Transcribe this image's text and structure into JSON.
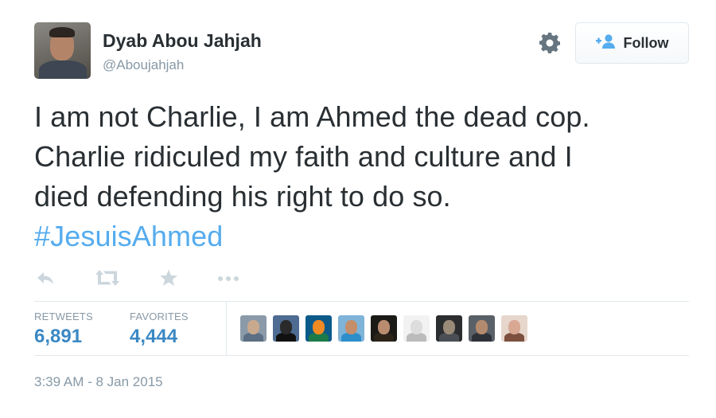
{
  "user": {
    "display_name": "Dyab Abou Jahjah",
    "handle": "@Aboujahjah"
  },
  "follow_button": {
    "label": "Follow",
    "icon": "add-person-icon"
  },
  "settings": {
    "icon": "gear-icon"
  },
  "tweet": {
    "lines": [
      "I am not Charlie, I am Ahmed the dead cop.",
      "Charlie ridiculed my faith and culture and I",
      "died defending his right to do so."
    ],
    "hashtag": "#JesuisAhmed"
  },
  "actions": [
    {
      "name": "reply",
      "icon": "reply-icon"
    },
    {
      "name": "retweet",
      "icon": "retweet-icon"
    },
    {
      "name": "favorite",
      "icon": "star-icon"
    },
    {
      "name": "more",
      "icon": "more-dots-icon"
    }
  ],
  "stats": {
    "retweets": {
      "label": "RETWEETS",
      "value": "6,891"
    },
    "favorites": {
      "label": "FAVORITES",
      "value": "4,444"
    }
  },
  "favoriters": [
    {
      "head": "#c9a98e",
      "body": "#5b6e84",
      "bg": "#8b9aa8"
    },
    {
      "head": "#2a2a2a",
      "body": "#111111",
      "bg": "#4e6c92"
    },
    {
      "head": "#f08a22",
      "body": "#1c7a4a",
      "bg": "#0b5a8a"
    },
    {
      "head": "#c48e6a",
      "body": "#2d8ec9",
      "bg": "#7fb3d8"
    },
    {
      "head": "#b98c70",
      "body": "#2c2418",
      "bg": "#1b1a17"
    },
    {
      "head": "#dddddd",
      "body": "#bbbbbb",
      "bg": "#f2f2f2"
    },
    {
      "head": "#9a8a78",
      "body": "#4a4f55",
      "bg": "#2b2d2f"
    },
    {
      "head": "#b48a6e",
      "body": "#2e3238",
      "bg": "#5a6068"
    },
    {
      "head": "#d8a892",
      "body": "#7d4f3e",
      "bg": "#e6d6cc"
    }
  ],
  "timestamp": "3:39 AM - 8 Jan 2015",
  "colors": {
    "link": "#55acee",
    "stat_value": "#3b88c3",
    "muted": "#8899a6",
    "text": "#292f33"
  }
}
